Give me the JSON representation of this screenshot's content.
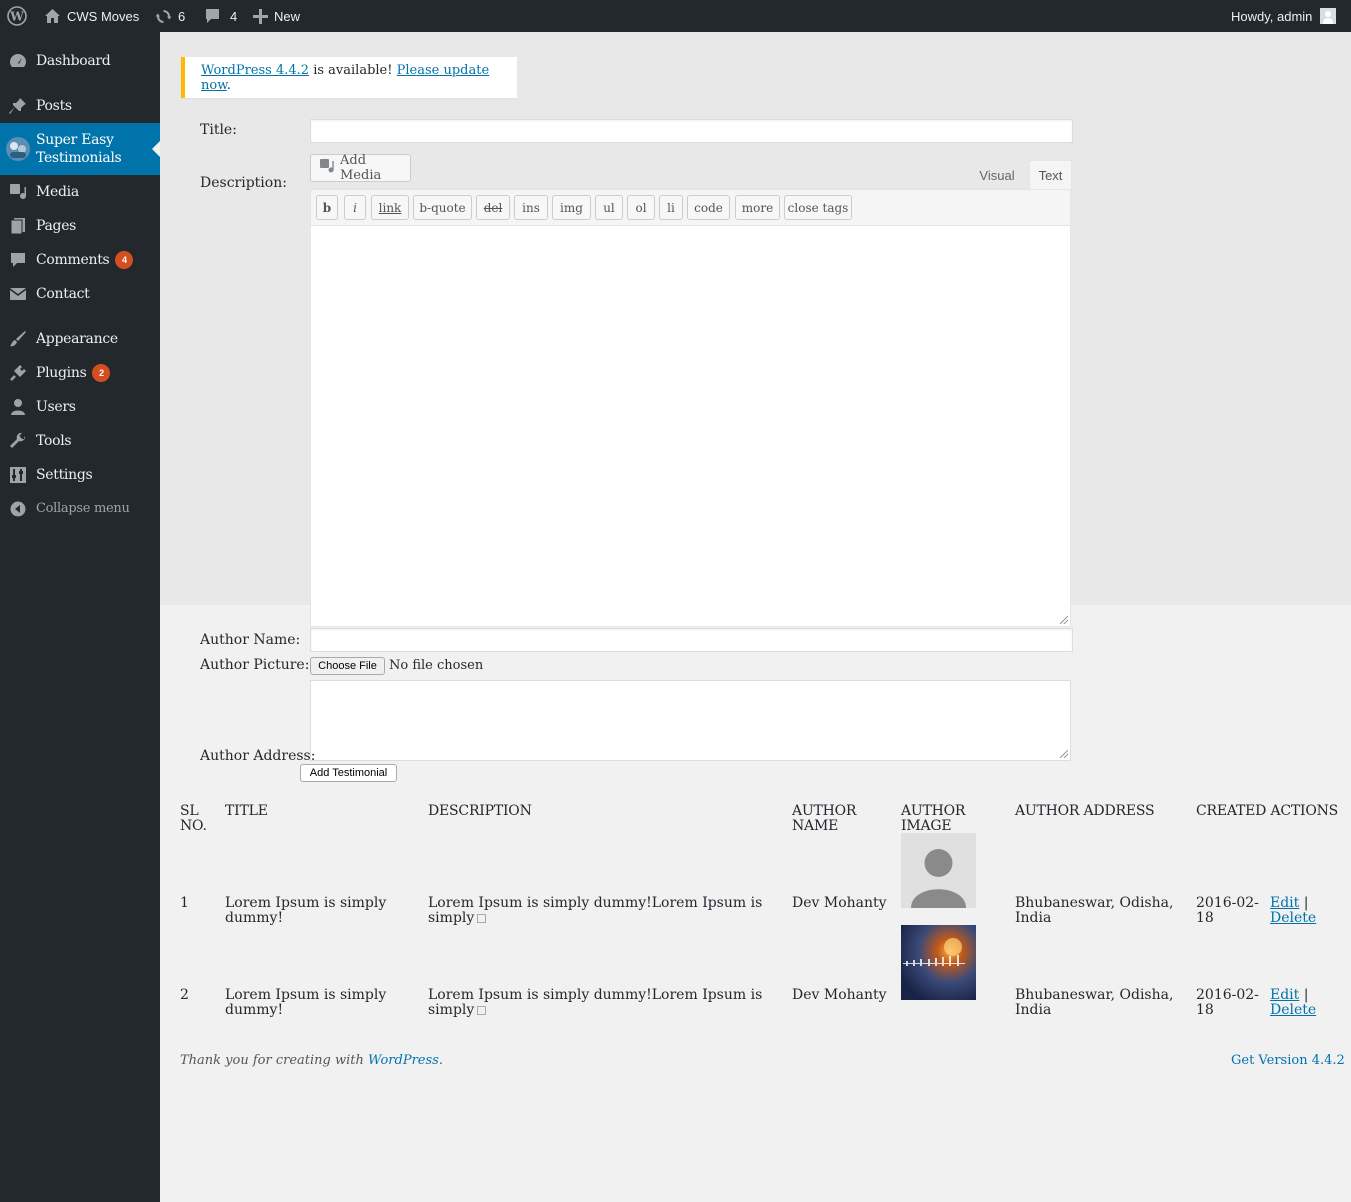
{
  "adminbar": {
    "site_name": "CWS Moves",
    "updates_count": "6",
    "comments_count": "4",
    "new_label": "New",
    "howdy": "Howdy, admin"
  },
  "sidebar": {
    "items": [
      {
        "label": "Dashboard"
      },
      {
        "label": "Posts"
      },
      {
        "label": "Super Easy Testimonials"
      },
      {
        "label": "Media"
      },
      {
        "label": "Pages"
      },
      {
        "label": "Comments",
        "badge": "4"
      },
      {
        "label": "Contact"
      },
      {
        "label": "Appearance"
      },
      {
        "label": "Plugins",
        "badge": "2"
      },
      {
        "label": "Users"
      },
      {
        "label": "Tools"
      },
      {
        "label": "Settings"
      }
    ],
    "collapse_label": "Collapse menu"
  },
  "notice": {
    "version_link": "WordPress 4.4.2",
    "middle_text": " is available! ",
    "update_link": "Please update now",
    "end_text": "."
  },
  "form": {
    "title_label": "Title:",
    "description_label": "Description:",
    "add_media_label": "Add Media",
    "tab_visual": "Visual",
    "tab_text": "Text",
    "quicktags": [
      "b",
      "i",
      "link",
      "b-quote",
      "del",
      "ins",
      "img",
      "ul",
      "ol",
      "li",
      "code",
      "more",
      "close tags"
    ],
    "author_name_label": "Author Name:",
    "author_picture_label": "Author Picture:",
    "choose_file_label": "Choose File",
    "no_file_text": "No file chosen",
    "author_address_label": "Author Address:",
    "add_button_label": "Add Testimonial"
  },
  "table": {
    "headers": {
      "sl": "SL NO.",
      "title": "TITLE",
      "description": "DESCRIPTION",
      "author_name": "AUTHOR NAME",
      "author_image": "AUTHOR IMAGE",
      "author_address": "AUTHOR ADDRESS",
      "created_actions": "CREATED ACTIONS"
    },
    "rows": [
      {
        "sl": "1",
        "title": "Lorem Ipsum is simply dummy!",
        "description": "Lorem Ipsum is simply dummy!Lorem Ipsum is simply",
        "author_name": "Dev Mohanty",
        "author_address": "Bhubaneswar, Odisha, India",
        "created": "2016-02-18",
        "edit": "Edit",
        "sep": " |",
        "delete": "Delete"
      },
      {
        "sl": "2",
        "title": "Lorem Ipsum is simply dummy!",
        "description": "Lorem Ipsum is simply dummy!Lorem Ipsum is simply",
        "author_name": "Dev Mohanty",
        "author_address": "Bhubaneswar, Odisha, India",
        "created": "2016-02-18",
        "edit": "Edit",
        "sep": " |",
        "delete": "Delete"
      }
    ]
  },
  "footer": {
    "thanks_text": "Thank you for creating with ",
    "wp_link": "WordPress",
    "thanks_end": ".",
    "version_link": "Get Version 4.4.2"
  },
  "colors": {
    "adminbar_bg": "#23282d",
    "accent": "#0073aa",
    "badge": "#d54e21",
    "notice_border": "#ffb900"
  },
  "icons": [
    "wordpress-logo-icon",
    "home-icon",
    "updates-icon",
    "comment-bubble-icon",
    "plus-icon",
    "dashboard-icon",
    "pin-icon",
    "media-icon",
    "pages-icon",
    "envelope-icon",
    "brush-icon",
    "plugin-icon",
    "user-icon",
    "wrench-icon",
    "settings-icon",
    "collapse-arrow-icon"
  ]
}
